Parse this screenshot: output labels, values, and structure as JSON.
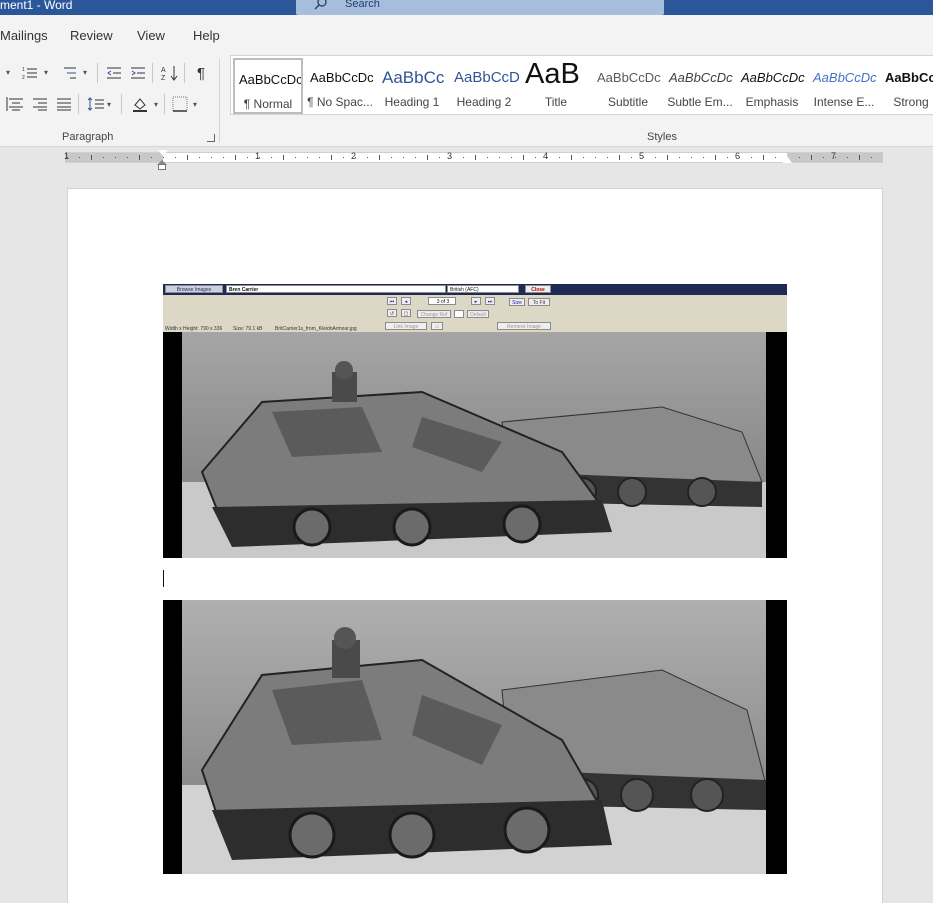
{
  "window": {
    "title": "ment1  -  Word"
  },
  "search": {
    "placeholder": "Search"
  },
  "menu": {
    "tabs": [
      "Mailings",
      "Review",
      "View",
      "Help"
    ]
  },
  "ribbon": {
    "paragraph_label": "Paragraph",
    "styles_label": "Styles",
    "styles": [
      {
        "sample": "AaBbCcDc",
        "name": "¶ Normal"
      },
      {
        "sample": "AaBbCcDc",
        "name": "¶ No Spac..."
      },
      {
        "sample": "AaBbCc",
        "name": "Heading 1"
      },
      {
        "sample": "AaBbCcD",
        "name": "Heading 2"
      },
      {
        "sample": "AaB",
        "name": "Title"
      },
      {
        "sample": "AaBbCcDc",
        "name": "Subtitle"
      },
      {
        "sample": "AaBbCcDc",
        "name": "Subtle Em..."
      },
      {
        "sample": "AaBbCcDc",
        "name": "Emphasis"
      },
      {
        "sample": "AaBbCcDc",
        "name": "Intense E..."
      },
      {
        "sample": "AaBbCcI",
        "name": "Strong"
      }
    ],
    "style_colors": {
      "heading": "#2f5597",
      "intense": "#4472c4"
    }
  },
  "ruler": {
    "numbers": [
      "1",
      "1",
      "2",
      "3",
      "4",
      "5",
      "6",
      "7"
    ]
  },
  "image_browser": {
    "browse_button": "Browse Images",
    "title_field": "Bren Carrier",
    "category_field": "British (AFC)",
    "close_button": "Close",
    "counter": "3 of 3",
    "size_button": "Size",
    "fit_button": "To Fit",
    "change_button": "Change Ref",
    "default_button": "Default",
    "link_button": "Link Image",
    "remove_button": "Remove Image",
    "status_dims": "Width x Height: 790 x 336",
    "status_size": "Size: 79.1 kB",
    "status_file": "BritCarrier1s_from_KleidnArmour.jpg"
  }
}
